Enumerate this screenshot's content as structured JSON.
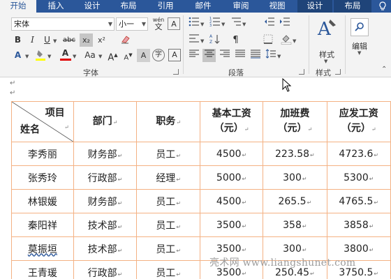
{
  "ribbon_tabs": [
    {
      "label": "开始",
      "active": true
    },
    {
      "label": "插入"
    },
    {
      "label": "设计"
    },
    {
      "label": "布局"
    },
    {
      "label": "引用"
    },
    {
      "label": "邮件"
    },
    {
      "label": "审阅"
    },
    {
      "label": "视图"
    },
    {
      "label": "设计",
      "context": true
    },
    {
      "label": "布局",
      "context": true
    }
  ],
  "font_group": {
    "font_name": "宋体",
    "font_size": "小一",
    "wen_label": "wén",
    "wen_char": "文",
    "bold": "B",
    "italic": "I",
    "underline": "U",
    "strike": "abc",
    "sub": "x₂",
    "sup": "x²",
    "font_color_a": "A",
    "case_label": "Aa",
    "grow": "A",
    "shrink": "A",
    "char_border": "A",
    "phonetic": "字",
    "label": "字体"
  },
  "para_group": {
    "label": "段落"
  },
  "style_group": {
    "styles_label": "样式",
    "label": "样式"
  },
  "edit_group": {
    "edit_label": "编辑"
  },
  "table": {
    "diag_top": "项目",
    "diag_bottom": "姓名",
    "headers": [
      {
        "line1": "部门"
      },
      {
        "line1": "职务"
      },
      {
        "line1": "基本工资",
        "line2": "（元）"
      },
      {
        "line1": "加班费",
        "line2": "（元）"
      },
      {
        "line1": "应发工资",
        "line2": "（元）"
      }
    ],
    "rows": [
      [
        "李秀丽",
        "财务部",
        "员工",
        "4500",
        "223.58",
        "4723.6"
      ],
      [
        "张秀玲",
        "行政部",
        "经理",
        "5000",
        "300",
        "5300"
      ],
      [
        "林银媛",
        "财务部",
        "员工",
        "4500",
        "265.5",
        "4765.5"
      ],
      [
        "秦阳祥",
        "技术部",
        "员工",
        "3500",
        "358",
        "3858"
      ],
      [
        "莫振垣",
        "技术部",
        "员工",
        "3500",
        "300",
        "3800"
      ],
      [
        "王青瑗",
        "行政部",
        "员工",
        "3500",
        "250.45",
        "3750.5"
      ]
    ]
  },
  "watermark": "亮术网 www.liangshunet.com",
  "colors": {
    "ribbon_blue": "#2b579a",
    "table_border": "#f4b183"
  }
}
